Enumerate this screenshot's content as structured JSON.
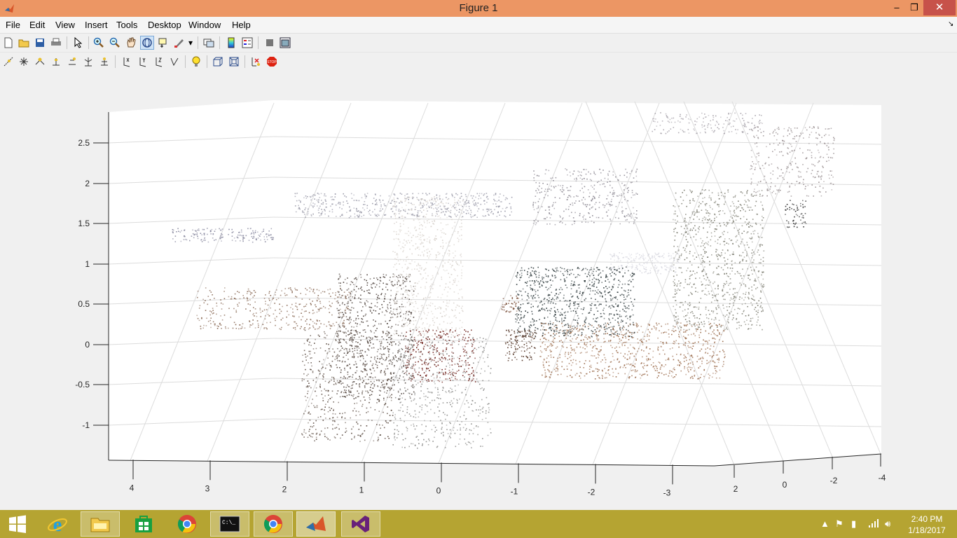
{
  "window": {
    "title": "Figure 1",
    "minimize_glyph": "–",
    "maximize_glyph": "❐",
    "close_glyph": "✕"
  },
  "menu": [
    "File",
    "Edit",
    "View",
    "Insert",
    "Tools",
    "Desktop",
    "Window",
    "Help"
  ],
  "toolbar1": [
    "new-figure-icon",
    "open-file-icon",
    "save-icon",
    "print-icon",
    "pointer-icon",
    "zoom-in-icon",
    "zoom-out-icon",
    "pan-icon",
    "rotate-3d-icon",
    "data-cursor-icon",
    "brush-icon",
    "link-plot-icon",
    "colorbar-icon",
    "legend-icon",
    "hide-plot-tools-icon",
    "show-plot-tools-icon"
  ],
  "toolbar2": [
    "camera-orbit-icon",
    "camera-light-icon",
    "camera-pan-icon",
    "camera-dolly-icon",
    "camera-move-icon",
    "camera-zoom-icon",
    "camera-roll-icon",
    "x-principal-axis-icon",
    "y-principal-axis-icon",
    "z-principal-axis-icon",
    "no-principal-axis-icon",
    "toggle-light-icon",
    "orthographic-projection-icon",
    "perspective-projection-icon",
    "reset-camera-icon",
    "stop-camera-icon"
  ],
  "chart_data": {
    "type": "scatter",
    "title": "",
    "description": "3D colored point cloud (Kinect scan of a room with a person)",
    "z_ticks": [
      "-1",
      "-0.5",
      "0",
      "0.5",
      "1",
      "1.5",
      "2",
      "2.5"
    ],
    "x_ticks": [
      "4",
      "3",
      "2",
      "1",
      "0",
      "-1",
      "-2",
      "-3"
    ],
    "y_ticks": [
      "2",
      "0",
      "-2",
      "-4"
    ],
    "grid": true,
    "colors": {
      "axis": "#262626",
      "grid": "#dcdcdc",
      "background": "#ffffff"
    }
  },
  "taskbar": {
    "apps": [
      "internet-explorer-icon",
      "file-explorer-icon",
      "store-icon",
      "chrome-icon",
      "command-prompt-icon",
      "chrome-icon",
      "matlab-icon",
      "visual-studio-icon"
    ],
    "clock_time": "2:40 PM",
    "clock_date": "1/18/2017"
  },
  "icons": {
    "tray": [
      "show-hidden-icons-icon",
      "action-center-icon",
      "power-icon",
      "network-icon",
      "volume-icon"
    ]
  }
}
